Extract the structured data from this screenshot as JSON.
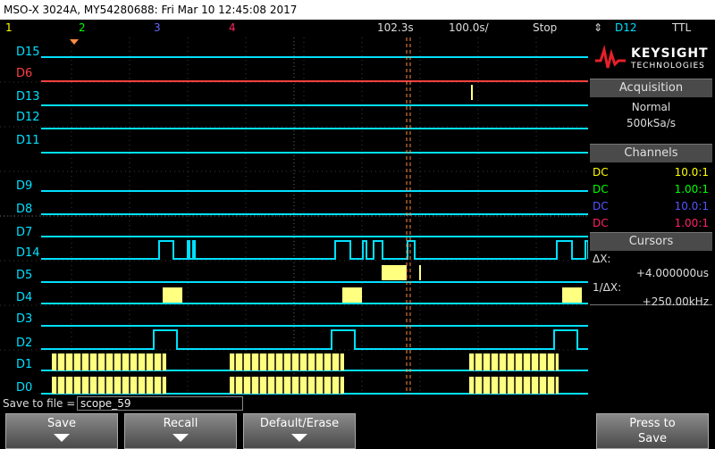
{
  "title": "MSO-X 3024A, MY54280688: Fri Mar 10 12:45:08 2017",
  "status": {
    "ch1": "1",
    "ch2": "2",
    "ch3": "3",
    "ch4": "4",
    "time_ref": "102.3s",
    "time_div": "100.0s/",
    "run_state": "Stop",
    "trig_chan": "D12",
    "trig_mode": "TTL"
  },
  "brand": {
    "name": "KEYSIGHT",
    "sub": "TECHNOLOGIES"
  },
  "acquisition": {
    "header": "Acquisition",
    "mode": "Normal",
    "rate": "500kSa/s"
  },
  "channels": {
    "header": "Channels",
    "rows": [
      {
        "coupling": "DC",
        "probe": "10.0:1",
        "color": "#ffff00"
      },
      {
        "coupling": "DC",
        "probe": "1.00:1",
        "color": "#00ff00"
      },
      {
        "coupling": "DC",
        "probe": "10.0:1",
        "color": "#5555ff"
      },
      {
        "coupling": "DC",
        "probe": "1.00:1",
        "color": "#ff2266"
      }
    ]
  },
  "cursors": {
    "header": "Cursors",
    "dx_label": "ΔX:",
    "dx_value": "+4.000000us",
    "inv_label": "1/ΔX:",
    "inv_value": "+250.00kHz"
  },
  "digital_labels": [
    "D15",
    "D6",
    "D13",
    "D12",
    "D11",
    "D9",
    "D8",
    "D7",
    "D14",
    "D5",
    "D4",
    "D3",
    "D2",
    "D1",
    "D0"
  ],
  "save": {
    "label": "Save to file =",
    "filename": "scope_59"
  },
  "softkeys": {
    "save": "Save",
    "recall": "Recall",
    "default_erase": "Default/Erase",
    "press_to": "Press to",
    "press_save": "Save"
  },
  "colors": {
    "digital": "#00e0ff",
    "bus": "#ffff80",
    "red_channel": "#ff4040",
    "cursor": "#ff8c40"
  }
}
